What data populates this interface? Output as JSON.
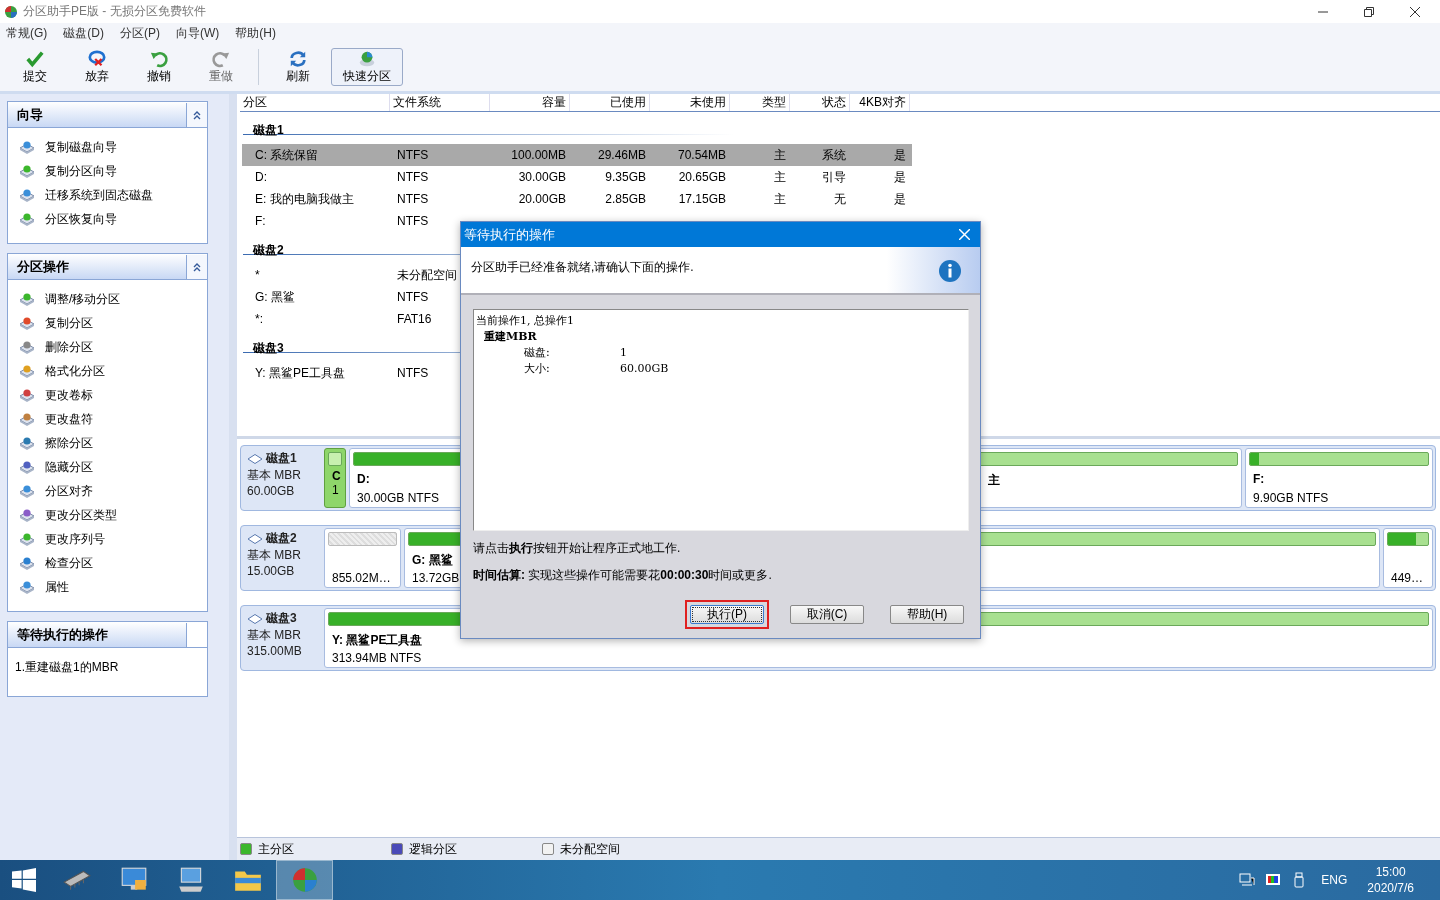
{
  "window": {
    "title": "分区助手PE版 - 无损分区免费软件"
  },
  "menu": [
    "常规(G)",
    "磁盘(D)",
    "分区(P)",
    "向导(W)",
    "帮助(H)"
  ],
  "toolbar": [
    {
      "kind": "commit",
      "label": "提交",
      "disabled": false,
      "highlighted": false
    },
    {
      "kind": "discard",
      "label": "放弃",
      "disabled": false,
      "highlighted": false
    },
    {
      "kind": "undo",
      "label": "撤销",
      "disabled": false,
      "highlighted": false
    },
    {
      "kind": "redo",
      "label": "重做",
      "disabled": true,
      "highlighted": false
    },
    {
      "kind": "refresh",
      "label": "刷新",
      "disabled": false,
      "highlighted": false
    },
    {
      "kind": "quick",
      "label": "快速分区",
      "disabled": false,
      "highlighted": true
    }
  ],
  "sidebar": [
    {
      "title": "向导",
      "collapse_button": true,
      "items": [
        "复制磁盘向导",
        "复制分区向导",
        "迁移系统到固态磁盘",
        "分区恢复向导"
      ]
    },
    {
      "title": "分区操作",
      "collapse_button": true,
      "items": [
        "调整/移动分区",
        "复制分区",
        "删除分区",
        "格式化分区",
        "更改卷标",
        "更改盘符",
        "擦除分区",
        "隐藏分区",
        "分区对齐",
        "更改分区类型",
        "更改序列号",
        "检查分区",
        "属性"
      ]
    },
    {
      "title": "等待执行的操作",
      "collapse_button": false,
      "text": "1.重建磁盘1的MBR"
    }
  ],
  "table": {
    "columns": [
      "分区",
      "文件系统",
      "容量",
      "已使用",
      "未使用",
      "类型",
      "状态",
      "4KB对齐"
    ],
    "disks": [
      {
        "name": "磁盘1",
        "rows": [
          {
            "cells": [
              "C: 系统保留",
              "NTFS",
              "100.00MB",
              "29.46MB",
              "70.54MB",
              "主",
              "系统",
              "是"
            ],
            "selected": true
          },
          {
            "cells": [
              "D:",
              "NTFS",
              "30.00GB",
              "9.35GB",
              "20.65GB",
              "主",
              "引导",
              "是"
            ],
            "selected": false
          },
          {
            "cells": [
              "E: 我的电脑我做主",
              "NTFS",
              "20.00GB",
              "2.85GB",
              "17.15GB",
              "主",
              "无",
              "是"
            ],
            "selected": false
          },
          {
            "cells": [
              "F:",
              "NTFS"
            ],
            "selected": false
          }
        ]
      },
      {
        "name": "磁盘2",
        "rows": [
          {
            "cells": [
              "*",
              "未分配空间"
            ],
            "selected": false
          },
          {
            "cells": [
              "G: 黑鲨",
              "NTFS"
            ],
            "selected": false
          },
          {
            "cells": [
              "*:",
              "FAT16"
            ],
            "selected": false
          }
        ]
      },
      {
        "name": "磁盘3",
        "rows": [
          {
            "cells": [
              "Y: 黑鲨PE工具盘",
              "NTFS"
            ],
            "selected": false
          }
        ]
      }
    ]
  },
  "disk_map": [
    {
      "name": "磁盘1",
      "type": "基本 MBR",
      "size": "60.00GB",
      "partitions": [
        {
          "kind": "primary",
          "name": "C",
          "detail": "1",
          "selected": true
        },
        {
          "kind": "primary",
          "name": "D:",
          "detail": "30.00GB NTFS",
          "level": 0.4,
          "selected": false
        },
        {
          "kind": "primary",
          "name": "主",
          "selected": false
        },
        {
          "kind": "primary",
          "name": "F:",
          "detail": "9.90GB NTFS",
          "level": 0.05,
          "selected": false
        }
      ]
    },
    {
      "name": "磁盘2",
      "type": "基本 MBR",
      "size": "15.00GB",
      "partitions": [
        {
          "kind": "unallocated",
          "detail": "855.02M…",
          "selected": false
        },
        {
          "kind": "primary",
          "name": "G: 黑鲨",
          "detail": "13.72GB",
          "level": 0.5,
          "selected": false
        },
        {
          "kind": "primary",
          "selected": false
        },
        {
          "kind": "primary",
          "detail": "449…",
          "level": 0.7,
          "selected": false
        }
      ]
    },
    {
      "name": "磁盘3",
      "type": "基本 MBR",
      "size": "315.00MB",
      "partitions": [
        {
          "kind": "primary",
          "name": "Y: 黑鲨PE工具盘",
          "detail": "313.94MB NTFS",
          "level": 0.4,
          "selected": false
        }
      ]
    }
  ],
  "legend": [
    {
      "label": "主分区",
      "color": "#3cb72c"
    },
    {
      "label": "逻辑分区",
      "color": "#4a4ab8"
    },
    {
      "label": "未分配空间",
      "color": "#f2f2f2"
    }
  ],
  "dialog": {
    "title": "等待执行的操作",
    "message": "分区助手已经准备就绪,请确认下面的操作.",
    "list": {
      "header": "当前操作1, 总操作1",
      "operation": "重建MBR",
      "fields": [
        {
          "label": "磁盘:",
          "value": "1"
        },
        {
          "label": "大小:",
          "value": "60.00GB"
        }
      ]
    },
    "instruction": "请点击**执行**按钮开始让程序正式地工作.",
    "estimate": "**时间估算:** 实现这些操作可能需要花**00:00:30**时间或更多.",
    "buttons": [
      {
        "label": "执行(P)",
        "highlighted": true
      },
      {
        "label": "取消(C)",
        "highlighted": false
      },
      {
        "label": "帮助(H)",
        "highlighted": false
      }
    ]
  },
  "taskbar": {
    "apps": [
      {
        "kind": "memory",
        "selected": false
      },
      {
        "kind": "monitor",
        "selected": false
      },
      {
        "kind": "computer",
        "selected": false
      },
      {
        "kind": "folder",
        "selected": false
      },
      {
        "kind": "partition",
        "selected": true
      }
    ],
    "language": "ENG",
    "time": "15:00",
    "date": "2020/7/6"
  }
}
